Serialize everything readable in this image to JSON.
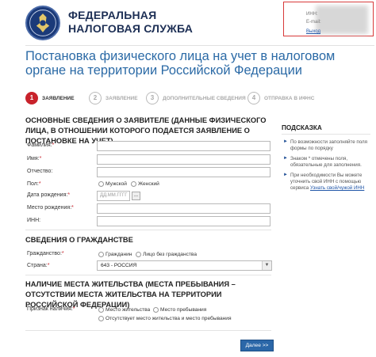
{
  "header": {
    "org_line1": "ФЕДЕРАЛЬНАЯ",
    "org_line2": "НАЛОГОВАЯ СЛУЖБА",
    "user_inn_label": "ИНН:",
    "user_email_label": "E-mail:",
    "logout_label": "Выход"
  },
  "page_title": "Постановка физического лица на учет в налоговом органе на территории Российской Федерации",
  "steps": [
    {
      "num": "1",
      "label": "ЗАЯВЛЕНИЕ"
    },
    {
      "num": "2",
      "label": "ЗАЯВЛЕНИЕ"
    },
    {
      "num": "3",
      "label": "ДОПОЛНИТЕЛЬНЫЕ СВЕДЕНИЯ"
    },
    {
      "num": "4",
      "label": "ОТПРАВКА В ИФНС"
    }
  ],
  "section_applicant": {
    "title": "Основные сведения о заявителе (данные физического лица, в отношении которого подается заявление о постановке на учет)",
    "surname_label": "Фамилия:",
    "name_label": "Имя:",
    "patronymic_label": "Отчество:",
    "sex_label": "Пол:",
    "sex_male": "Мужской",
    "sex_female": "Женский",
    "birthdate_label": "Дата рождения:",
    "birthdate_placeholder": "ДД.ММ.ГГГГ",
    "calendar_button": "...",
    "birthplace_label": "Место рождения:",
    "inn_label": "ИНН:",
    "required_mark": "*"
  },
  "section_citizenship": {
    "title": "Сведения о гражданстве",
    "citizenship_label": "Гражданство:",
    "opt_citizen": "Гражданин",
    "opt_stateless": "Лицо без гражданства",
    "country_label": "Страна:",
    "country_value": "643 - РОССИЯ",
    "required_mark": "*"
  },
  "section_residence": {
    "title": "Наличие места жительства (места пребывания – отсутствии места жительства на территории Российской Федерации)",
    "flag_label": "Признак наличия:",
    "opt_residence": "Место жительства",
    "opt_stay": "Место пребывания",
    "opt_none": "Отсутствует место жительства и место пребывания",
    "required_mark": "*"
  },
  "hints": {
    "title": "ПОДСКАЗКА",
    "items": [
      "По возможности заполняйте поля формы по порядку",
      "Знаком * отмечены поля, обязательные для заполнения.",
      "При необходимости Вы можете уточнить свой ИНН с помощью сервиса"
    ],
    "link_text": "Узнать свой/чужой ИНН"
  },
  "next_button": "Далее >>",
  "colors": {
    "brand_blue": "#2b6aa6",
    "active_step": "#c8222b",
    "button": "#2b67a8"
  }
}
